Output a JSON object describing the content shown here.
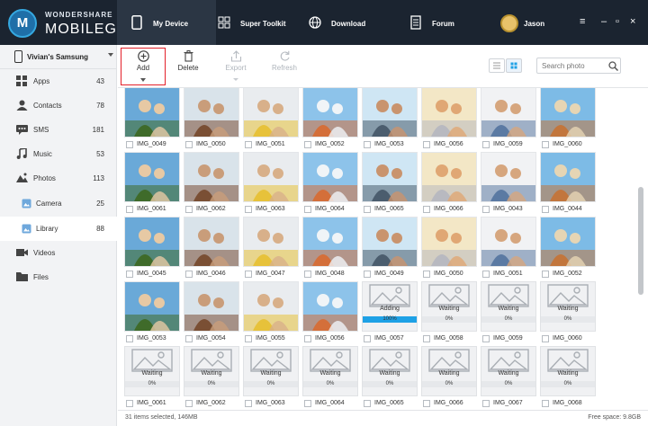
{
  "brand": {
    "line1": "WONDERSHARE",
    "line2": "MOBILEGO",
    "logo_letter": "M",
    "accent": "#1ea1e6"
  },
  "nav": [
    {
      "label": "My Device",
      "icon": "phone-icon",
      "active": true
    },
    {
      "label": "Super Toolkit",
      "icon": "toolkit-grid-icon"
    },
    {
      "label": "Download",
      "icon": "globe-icon"
    },
    {
      "label": "Forum",
      "icon": "forum-icon"
    }
  ],
  "user": {
    "name": "Jason"
  },
  "sidebar": {
    "device": "Vivian's Samsung",
    "items": [
      {
        "label": "Apps",
        "count": "43",
        "icon": "apps-icon"
      },
      {
        "label": "Contacts",
        "count": "78",
        "icon": "contacts-icon"
      },
      {
        "label": "SMS",
        "count": "181",
        "icon": "sms-icon"
      },
      {
        "label": "Music",
        "count": "53",
        "icon": "music-icon"
      },
      {
        "label": "Photos",
        "count": "113",
        "icon": "photos-icon"
      },
      {
        "label": "Camera",
        "count": "25",
        "icon": "camera-icon"
      },
      {
        "label": "Library",
        "count": "88",
        "icon": "library-icon"
      },
      {
        "label": "Videos",
        "count": "",
        "icon": "videos-icon"
      },
      {
        "label": "Files",
        "count": "",
        "icon": "files-icon"
      }
    ]
  },
  "toolbar": {
    "add": "Add",
    "delete": "Delete",
    "export": "Export",
    "refresh": "Refresh",
    "search_placeholder": "Search photo"
  },
  "photos": [
    {
      "name": "IMG_0049"
    },
    {
      "name": "IMG_0050"
    },
    {
      "name": "IMG_0051"
    },
    {
      "name": "IMG_0052"
    },
    {
      "name": "IMG_0053"
    },
    {
      "name": "IMG_0056"
    },
    {
      "name": "IMG_0059"
    },
    {
      "name": "IMG_0060"
    },
    {
      "name": "IMG_0061"
    },
    {
      "name": "IMG_0062"
    },
    {
      "name": "IMG_0063"
    },
    {
      "name": "IMG_0064"
    },
    {
      "name": "IMG_0065"
    },
    {
      "name": "IMG_0066"
    },
    {
      "name": "IMG_0043"
    },
    {
      "name": "IMG_0044"
    },
    {
      "name": "IMG_0045"
    },
    {
      "name": "IMG_0046"
    },
    {
      "name": "IMG_0047"
    },
    {
      "name": "IMG_0048"
    },
    {
      "name": "IMG_0049"
    },
    {
      "name": "IMG_0050"
    },
    {
      "name": "IMG_0051"
    },
    {
      "name": "IMG_0052"
    },
    {
      "name": "IMG_0053"
    },
    {
      "name": "IMG_0054"
    },
    {
      "name": "IMG_0055"
    },
    {
      "name": "IMG_0056"
    },
    {
      "name": "IMG_0057",
      "status": "Adding",
      "progress": "100%",
      "fill": 1.0
    },
    {
      "name": "IMG_0058",
      "status": "Waiting",
      "progress": "0%",
      "fill": 0
    },
    {
      "name": "IMG_0059",
      "status": "Waiting",
      "progress": "0%",
      "fill": 0
    },
    {
      "name": "IMG_0060",
      "status": "Waiting",
      "progress": "0%",
      "fill": 0
    },
    {
      "name": "IMG_0061",
      "status": "Waiting",
      "progress": "0%",
      "fill": 0
    },
    {
      "name": "IMG_0062",
      "status": "Waiting",
      "progress": "0%",
      "fill": 0
    },
    {
      "name": "IMG_0063",
      "status": "Waiting",
      "progress": "0%",
      "fill": 0
    },
    {
      "name": "IMG_0064",
      "status": "Waiting",
      "progress": "0%",
      "fill": 0
    },
    {
      "name": "IMG_0065",
      "status": "Waiting",
      "progress": "0%",
      "fill": 0
    },
    {
      "name": "IMG_0066",
      "status": "Waiting",
      "progress": "0%",
      "fill": 0
    },
    {
      "name": "IMG_0067",
      "status": "Waiting",
      "progress": "0%",
      "fill": 0
    },
    {
      "name": "IMG_0068",
      "status": "Waiting",
      "progress": "0%",
      "fill": 0
    }
  ],
  "status": {
    "selection": "31 items selected, 146MB",
    "free_space": "Free space: 9.8GB"
  }
}
